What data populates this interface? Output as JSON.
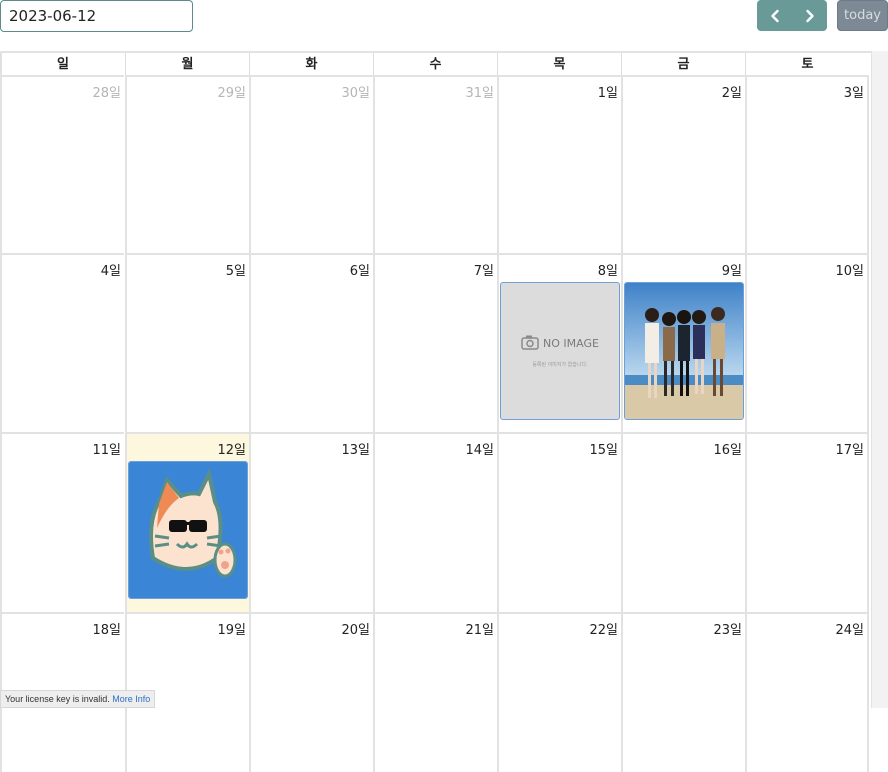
{
  "toolbar": {
    "date_value": "2023-06-12",
    "prev_icon": "chevron-left-icon",
    "next_icon": "chevron-right-icon",
    "today_label": "today"
  },
  "weekdays": [
    "일",
    "월",
    "화",
    "수",
    "목",
    "금",
    "토"
  ],
  "weeks": [
    [
      {
        "label": "28일",
        "other": true
      },
      {
        "label": "29일",
        "other": true
      },
      {
        "label": "30일",
        "other": true
      },
      {
        "label": "31일",
        "other": true
      },
      {
        "label": "1일"
      },
      {
        "label": "2일"
      },
      {
        "label": "3일"
      }
    ],
    [
      {
        "label": "4일"
      },
      {
        "label": "5일"
      },
      {
        "label": "6일"
      },
      {
        "label": "7일"
      },
      {
        "label": "8일",
        "event": "noimage"
      },
      {
        "label": "9일",
        "event": "photo"
      },
      {
        "label": "10일"
      }
    ],
    [
      {
        "label": "11일"
      },
      {
        "label": "12일",
        "today": true,
        "event": "cat"
      },
      {
        "label": "13일"
      },
      {
        "label": "14일"
      },
      {
        "label": "15일"
      },
      {
        "label": "16일"
      },
      {
        "label": "17일"
      }
    ],
    [
      {
        "label": "18일"
      },
      {
        "label": "19일"
      },
      {
        "label": "20일"
      },
      {
        "label": "21일"
      },
      {
        "label": "22일"
      },
      {
        "label": "23일"
      },
      {
        "label": "24일"
      }
    ]
  ],
  "no_image": {
    "title": "NO IMAGE",
    "caption": "등록된 이미지가 없습니다."
  },
  "license": {
    "text": "Your license key is invalid.",
    "link": "More Info"
  },
  "colors": {
    "today_bg": "#fdf7dd",
    "event_border": "#6e9fd8",
    "nav_bg": "#6a9a98",
    "today_btn_bg": "#7d8a96",
    "cat_bg": "#3a85d6"
  }
}
